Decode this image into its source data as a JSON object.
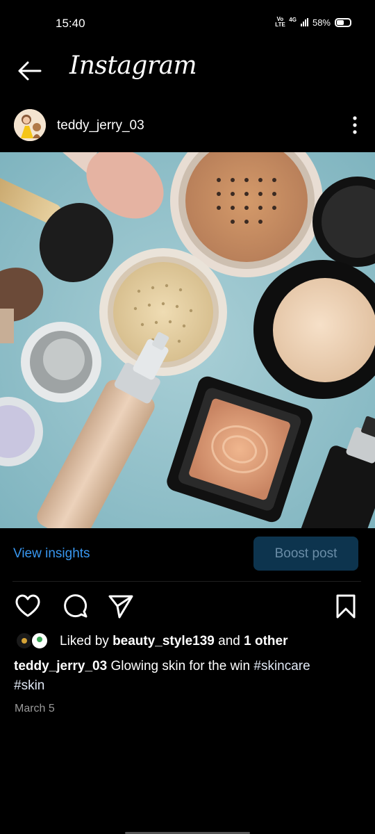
{
  "status_bar": {
    "time": "15:40",
    "network_volte": "Vo LTE",
    "network_type": "4G",
    "battery_percent": "58%",
    "battery_level": 0.58
  },
  "header": {
    "brand": "Instagram",
    "back_icon": "arrow-left-icon"
  },
  "post": {
    "username": "teddy_jerry_03",
    "more_icon": "more-vertical-icon",
    "image_subject": "makeup-products"
  },
  "insights": {
    "view_label": "View insights",
    "boost_label": "Boost post"
  },
  "actions": {
    "like_icon": "heart-icon",
    "comment_icon": "comment-icon",
    "share_icon": "send-icon",
    "save_icon": "bookmark-icon"
  },
  "likes": {
    "prefix": "Liked by",
    "liker": "beauty_style139",
    "connector": "and",
    "others": "1 other"
  },
  "caption": {
    "username": "teddy_jerry_03",
    "text": "Glowing skin for the win",
    "tag1": "#skincare",
    "tag2": "#skin"
  },
  "date": "March 5",
  "colors": {
    "background": "#000000",
    "link_blue": "#3897f0",
    "boost_bg": "#0d344e",
    "boost_text": "#6a8da7",
    "muted_text": "#9a9a9a"
  }
}
